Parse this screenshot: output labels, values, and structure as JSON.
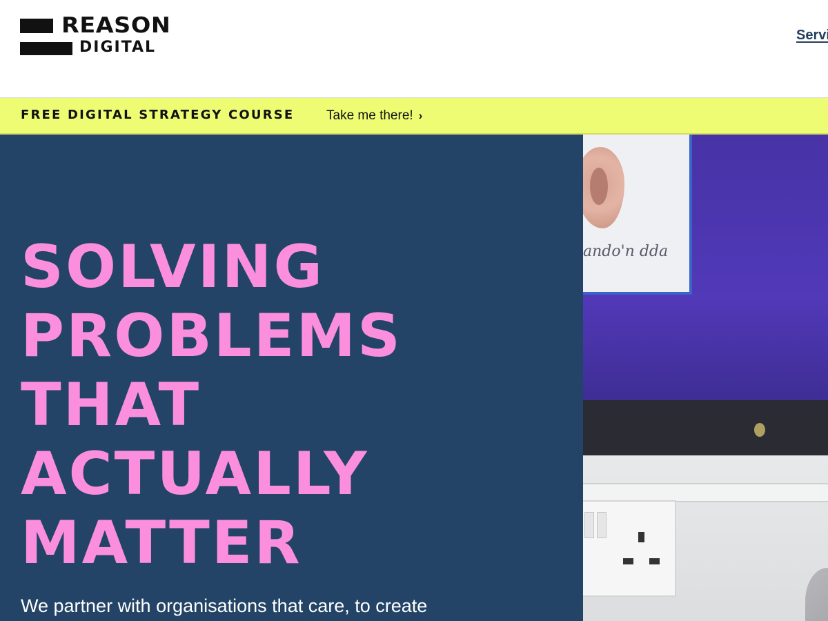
{
  "brand": {
    "logo_line1": "REASON",
    "logo_line2": "DIGITAL"
  },
  "nav": {
    "items": [
      {
        "label": "Servi"
      }
    ]
  },
  "promo": {
    "title": "FREE DIGITAL STRATEGY COURSE",
    "link_label": "Take me there!",
    "link_icon": "chevron-right-icon"
  },
  "hero": {
    "title_lines": [
      "SOLVING",
      "PROBLEMS",
      "THAT",
      "ACTUALLY",
      "MATTER"
    ],
    "subtitle": "We partner with organisations that care, to create",
    "photo_sign_text": "ando'n dda"
  },
  "colors": {
    "hero_bg": "#234466",
    "hero_title": "#fb8fde",
    "promo_bg": "#eefc74",
    "nav_link": "#243d5e",
    "text_dark": "#111111"
  }
}
